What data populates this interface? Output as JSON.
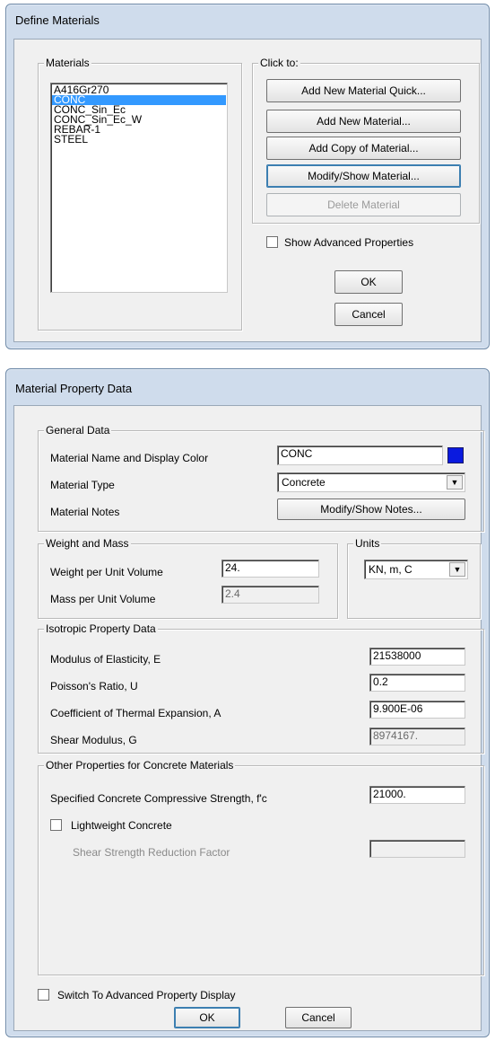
{
  "define_materials": {
    "title": "Define Materials",
    "materials_group": "Materials",
    "materials": [
      "A416Gr270",
      "CONC",
      "CONC_Sin_Ec",
      "CONC_Sin_Ec_W",
      "REBAR-1",
      "STEEL"
    ],
    "selected_material": "CONC",
    "click_to_group": "Click to:",
    "buttons": {
      "add_quick": "Add New Material Quick...",
      "add_new": "Add New Material...",
      "add_copy": "Add Copy of Material...",
      "modify_show": "Modify/Show Material...",
      "delete": "Delete Material"
    },
    "show_advanced_label": "Show Advanced Properties",
    "ok": "OK",
    "cancel": "Cancel"
  },
  "material_property": {
    "title": "Material Property Data",
    "general": {
      "group": "General Data",
      "name_label": "Material Name and Display Color",
      "name_value": "CONC",
      "display_color": "#0a1adf",
      "type_label": "Material Type",
      "type_value": "Concrete",
      "notes_label": "Material Notes",
      "notes_button": "Modify/Show Notes..."
    },
    "weight": {
      "group": "Weight and Mass",
      "weight_label": "Weight per Unit Volume",
      "weight_value": "24.",
      "mass_label": "Mass per Unit Volume",
      "mass_value": "2.4"
    },
    "units": {
      "group": "Units",
      "value": "KN, m, C"
    },
    "isotropic": {
      "group": "Isotropic Property Data",
      "e_label": "Modulus of Elasticity,  E",
      "e_value": "21538000",
      "u_label": "Poisson's Ratio,  U",
      "u_value": "0.2",
      "a_label": "Coefficient of Thermal Expansion,  A",
      "a_value": "9.900E-06",
      "g_label": "Shear Modulus,  G",
      "g_value": "8974167."
    },
    "concrete": {
      "group": "Other Properties for Concrete Materials",
      "fc_label": "Specified Concrete Compressive Strength, f'c",
      "fc_value": "21000.",
      "lightweight_label": "Lightweight Concrete",
      "shear_factor_label": "Shear Strength Reduction Factor",
      "shear_factor_value": ""
    },
    "switch_label": "Switch To Advanced Property Display",
    "ok": "OK",
    "cancel": "Cancel"
  }
}
